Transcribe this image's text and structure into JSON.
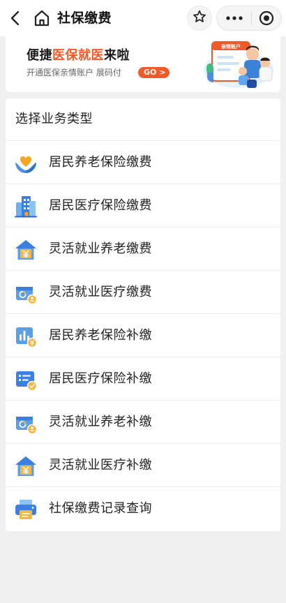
{
  "navbar": {
    "title": "社保缴费",
    "back_icon": "chevron-left-icon",
    "home_icon": "home-icon",
    "star_icon": "star-outline-icon",
    "more_icon": "more-dots-icon",
    "close_icon": "target-circle-icon"
  },
  "banner": {
    "headline_pre": "便捷",
    "headline_highlight": "医保就医",
    "headline_post": "来啦",
    "subtitle": "开通医保亲情账户 展码付",
    "go_label": "GO >",
    "art_tag": "亲情账户",
    "accent_color": "#f05a28"
  },
  "panel": {
    "title": "选择业务类型",
    "items": [
      {
        "label": "居民养老保险缴费",
        "icon": "hands-heart-icon"
      },
      {
        "label": "居民医疗保险缴费",
        "icon": "building-icon"
      },
      {
        "label": "灵活就业养老缴费",
        "icon": "house-yen-icon"
      },
      {
        "label": "灵活就业医疗缴费",
        "icon": "card-user-icon"
      },
      {
        "label": "居民养老保险补缴",
        "icon": "chart-yen-icon"
      },
      {
        "label": "居民医疗保险补缴",
        "icon": "card-check-icon"
      },
      {
        "label": "灵活就业养老补缴",
        "icon": "card-user-icon"
      },
      {
        "label": "灵活就业医疗补缴",
        "icon": "house-yen-icon"
      },
      {
        "label": "社保缴费记录查询",
        "icon": "printer-icon"
      }
    ]
  }
}
